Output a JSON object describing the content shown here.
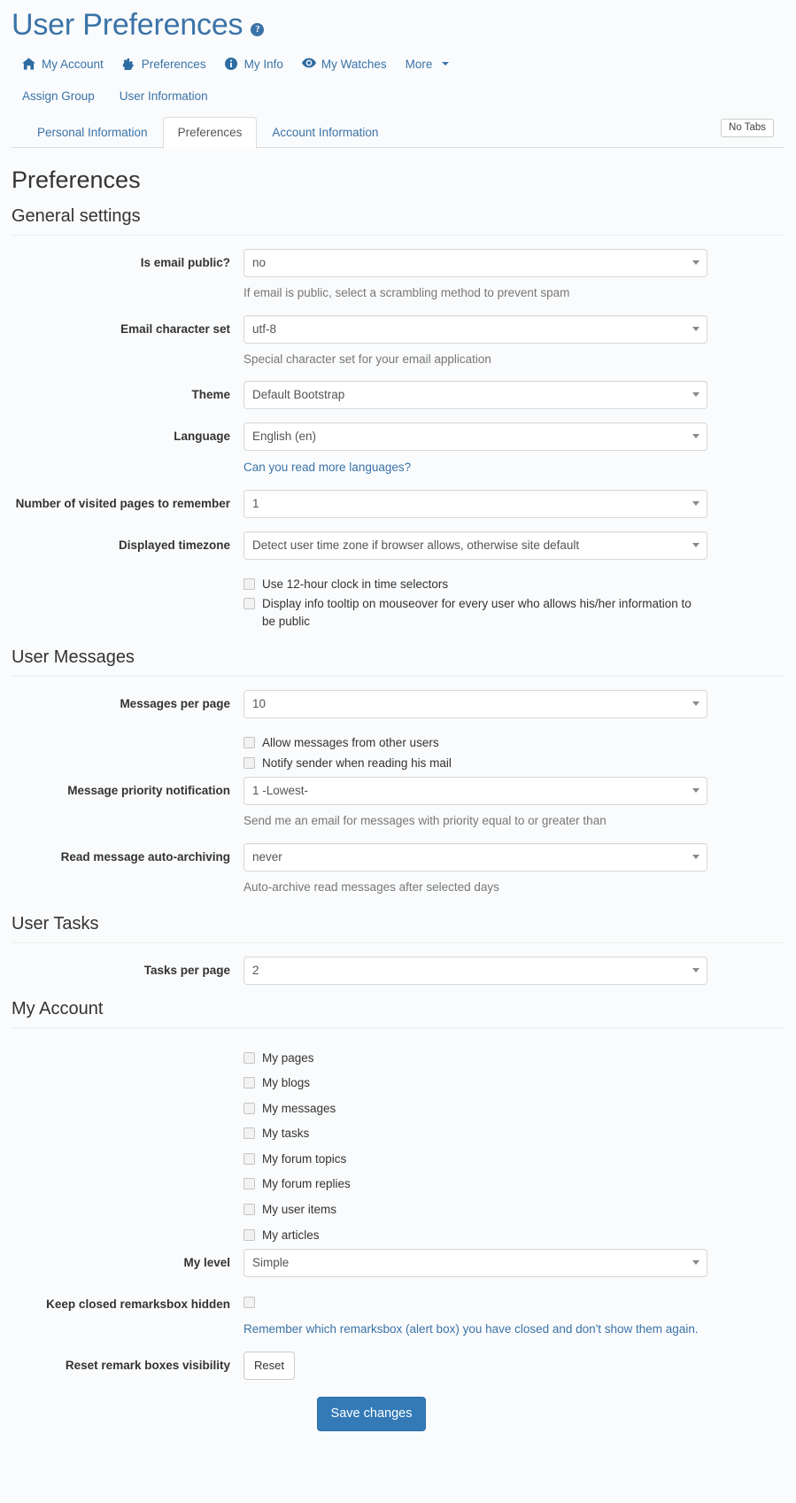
{
  "header": {
    "title": "User Preferences",
    "help_icon": "question-mark-icon",
    "help_glyph": "?"
  },
  "module_nav": [
    {
      "label": "My Account",
      "icon": "home-icon"
    },
    {
      "label": "Preferences",
      "icon": "gear-icon"
    },
    {
      "label": "My Info",
      "icon": "info-icon"
    },
    {
      "label": "My Watches",
      "icon": "eye-icon"
    },
    {
      "label": "More",
      "icon": "chevron-down-icon"
    }
  ],
  "sub_links": [
    {
      "label": "Assign Group"
    },
    {
      "label": "User Information"
    }
  ],
  "tabs": [
    {
      "label": "Personal Information",
      "active": false
    },
    {
      "label": "Preferences",
      "active": true
    },
    {
      "label": "Account Information",
      "active": false
    }
  ],
  "no_tabs_badge": "No Tabs",
  "content": {
    "title": "Preferences"
  },
  "sections": {
    "general": {
      "title": "General settings",
      "is_email_public": {
        "label": "Is email public?",
        "value": "no",
        "help": "If email is public, select a scrambling method to prevent spam"
      },
      "email_charset": {
        "label": "Email character set",
        "value": "utf-8",
        "help": "Special character set for your email application"
      },
      "theme": {
        "label": "Theme",
        "value": "Default Bootstrap"
      },
      "language": {
        "label": "Language",
        "value": "English (en)",
        "link": "Can you read more languages?"
      },
      "visited_pages": {
        "label": "Number of visited pages to remember",
        "value": "1"
      },
      "timezone": {
        "label": "Displayed timezone",
        "value": "Detect user time zone if browser allows, otherwise site default"
      },
      "checkboxes": [
        {
          "label": "Use 12-hour clock in time selectors",
          "checked": false
        },
        {
          "label": "Display info tooltip on mouseover for every user who allows his/her information to be public",
          "checked": false
        }
      ]
    },
    "messages": {
      "title": "User Messages",
      "messages_per_page": {
        "label": "Messages per page",
        "value": "10"
      },
      "checkboxes": [
        {
          "label": "Allow messages from other users",
          "checked": false
        },
        {
          "label": "Notify sender when reading his mail",
          "checked": false
        }
      ],
      "priority": {
        "label": "Message priority notification",
        "value": "1 -Lowest-",
        "help": "Send me an email for messages with priority equal to or greater than"
      },
      "auto_archive": {
        "label": "Read message auto-archiving",
        "value": "never",
        "help": "Auto-archive read messages after selected days"
      }
    },
    "tasks": {
      "title": "User Tasks",
      "tasks_per_page": {
        "label": "Tasks per page",
        "value": "2"
      }
    },
    "account": {
      "title": "My Account",
      "checkboxes": [
        {
          "label": "My pages",
          "checked": false
        },
        {
          "label": "My blogs",
          "checked": false
        },
        {
          "label": "My messages",
          "checked": false
        },
        {
          "label": "My tasks",
          "checked": false
        },
        {
          "label": "My forum topics",
          "checked": false
        },
        {
          "label": "My forum replies",
          "checked": false
        },
        {
          "label": "My user items",
          "checked": false
        },
        {
          "label": "My articles",
          "checked": false
        }
      ],
      "my_level": {
        "label": "My level",
        "value": "Simple"
      },
      "remarksbox": {
        "label": "Keep closed remarksbox hidden",
        "checked": false,
        "link": "Remember which remarksbox (alert box) you have closed and don't show them again."
      },
      "reset": {
        "label": "Reset remark boxes visibility",
        "button": "Reset"
      }
    }
  },
  "footer": {
    "save_label": "Save changes"
  },
  "colors": {
    "link": "#3a73a8",
    "primary_button": "#337ab7",
    "text": "#333333",
    "muted": "#777777"
  }
}
